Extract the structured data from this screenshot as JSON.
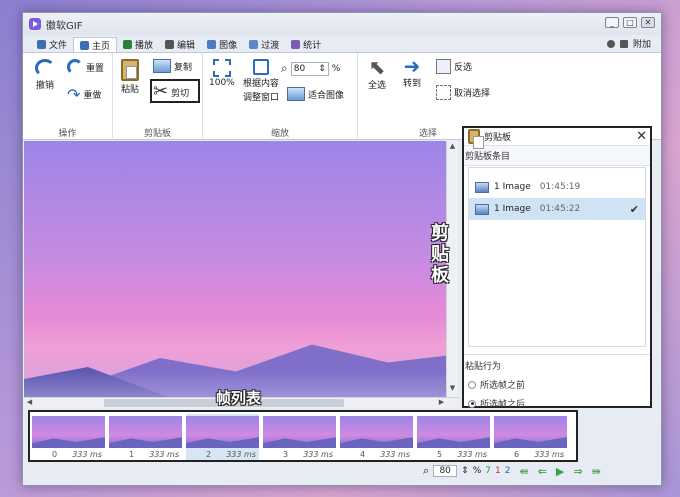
{
  "window": {
    "title": "徽软GIF",
    "controls": [
      "_",
      "□",
      "✕"
    ]
  },
  "tabs": [
    {
      "label": "文件",
      "icon": "save-icon",
      "color": "#3b6fb5"
    },
    {
      "label": "主页",
      "icon": "home-icon",
      "color": "#3b6fb5",
      "active": true
    },
    {
      "label": "播放",
      "icon": "play-icon",
      "color": "#2a7f3a"
    },
    {
      "label": "编辑",
      "icon": "pencil-icon",
      "color": "#555555"
    },
    {
      "label": "图像",
      "icon": "image-icon",
      "color": "#4a7bc0"
    },
    {
      "label": "过渡",
      "icon": "transition-icon",
      "color": "#5a88c8"
    },
    {
      "label": "统计",
      "icon": "stats-icon",
      "color": "#7a5bb0"
    }
  ],
  "tabbar_right": {
    "extra_label": "附加"
  },
  "ribbon": {
    "actions": {
      "undo": "撤销",
      "redo": "重做",
      "reset": "重置",
      "group": "操作"
    },
    "clipboard": {
      "paste": "粘贴",
      "copy": "复制",
      "cut": "剪切",
      "group": "剪贴板"
    },
    "zoom": {
      "percent100": "100%",
      "fit_window": [
        "根据内容",
        "调整窗口"
      ],
      "zoom_value": "80",
      "percent_sign": "%",
      "fit_image": "适合图像",
      "group": "缩放"
    },
    "select": {
      "select_all": "全选",
      "goto": "转到",
      "invert": "反选",
      "deselect": "取消选择",
      "group": "选择"
    }
  },
  "clipboard_panel": {
    "title": "剪贴板",
    "entries_label": "剪贴板条目",
    "items": [
      {
        "label": "1 Image",
        "time": "01:45:19",
        "selected": false
      },
      {
        "label": "1 Image",
        "time": "01:45:22",
        "selected": true
      }
    ],
    "paste_behavior_label": "粘贴行为",
    "options": [
      {
        "label": "所选帧之前",
        "checked": false
      },
      {
        "label": "所选帧之后",
        "checked": true
      }
    ]
  },
  "annotations": {
    "clipboard": [
      "剪",
      "贴",
      "板"
    ],
    "frame_list": "帧列表"
  },
  "frames": [
    {
      "index": "0",
      "duration": "333 ms",
      "selected": false
    },
    {
      "index": "1",
      "duration": "333 ms",
      "selected": false
    },
    {
      "index": "2",
      "duration": "333 ms",
      "selected": true
    },
    {
      "index": "3",
      "duration": "333 ms",
      "selected": false
    },
    {
      "index": "4",
      "duration": "333 ms",
      "selected": false
    },
    {
      "index": "5",
      "duration": "333 ms",
      "selected": false
    },
    {
      "index": "6",
      "duration": "333 ms",
      "selected": false
    }
  ],
  "statusbar": {
    "zoom": "80",
    "percent_sign": "%",
    "total": "7",
    "selected_count": "1",
    "current": "2",
    "total_color": "#2a9d3a",
    "selected_color": "#c03030",
    "current_color": "#3060c0"
  }
}
